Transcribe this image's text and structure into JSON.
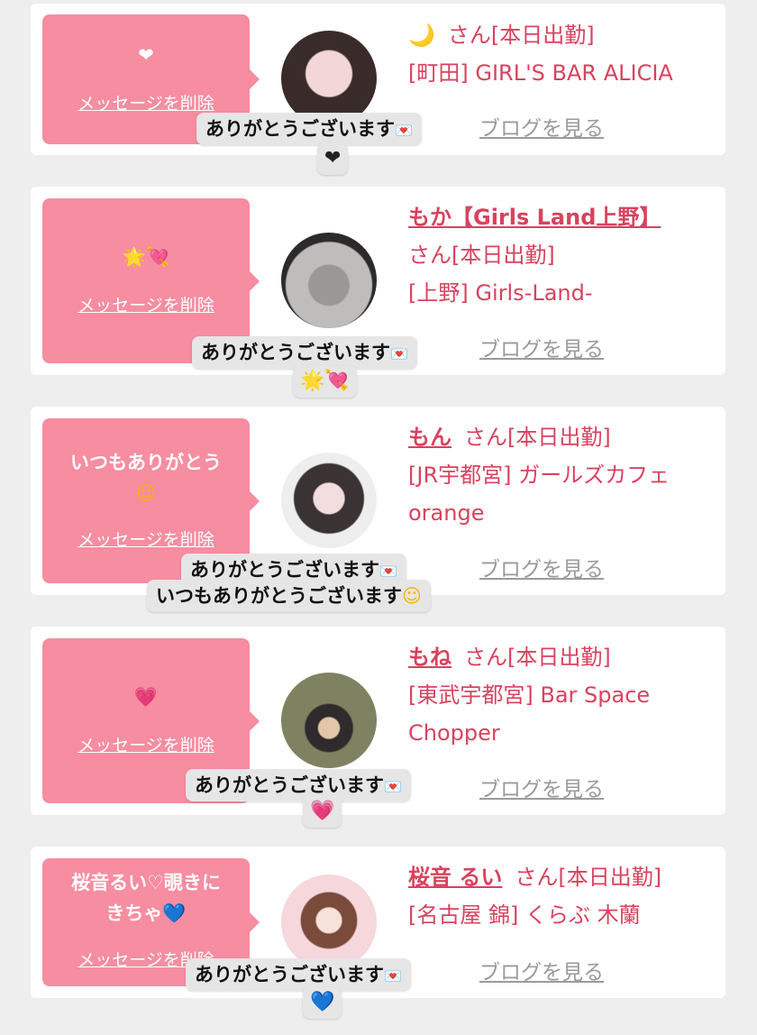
{
  "delete_label": "メッセージを削除",
  "san_suffix": "さん[本日出勤]",
  "blog_label": "ブログを見る",
  "thanks_prefix": "ありがとうございます",
  "icons": {
    "envelope": "💌",
    "heart_white": "❤",
    "heart_black": "❤",
    "star": "🌟",
    "heart_arrow": "💘",
    "smile": "☺",
    "heart_pink": "💗",
    "heart_blue": "💙",
    "moon": "🌙"
  },
  "cards": [
    {
      "bubble_icon": "❤",
      "name": "🌙",
      "san": "さん[本日出勤]",
      "shop_lines": [
        "[町田] GIRL'S BAR ALICIA"
      ],
      "reply_icon": "❤",
      "avatar_colors": [
        "#f3d6d6",
        "#3a2b2b"
      ]
    },
    {
      "bubble_icon": "🌟💘",
      "name": "もか【Girls Land上野】",
      "san": "さん[本日出勤]",
      "shop_lines": [
        "[上野] Girls-Land-"
      ],
      "reply_icon": "🌟💘",
      "avatar_colors": [
        "#bfbcbc",
        "#2c2a2a"
      ]
    },
    {
      "bubble_text": "いつもありがとう",
      "bubble_icon": "☺",
      "name": "もん",
      "san": "さん[本日出勤]",
      "shop_lines": [
        "[JR宇都宮] ガールズカフェ",
        "orange"
      ],
      "reply_text": "いつもありがとうございます",
      "reply_icon": "☺",
      "avatar_colors": [
        "#eeeeee",
        "#3b3333"
      ]
    },
    {
      "bubble_icon": "💗",
      "name": "もね",
      "san": "さん[本日出勤]",
      "shop_lines": [
        "[東武宇都宮] Bar Space",
        "Chopper"
      ],
      "reply_icon": "💗",
      "avatar_colors": [
        "#7e8261",
        "#2f2a2c"
      ]
    },
    {
      "bubble_text": "桜音るい♡覗きに",
      "bubble_text2": "きちゃ",
      "bubble_icon": "💙",
      "name": "桜音 るい",
      "san": "さん[本日出勤]",
      "shop_lines": [
        "[名古屋 錦] くらぶ 木蘭"
      ],
      "reply_icon": "💙",
      "avatar_colors": [
        "#f6d7dc",
        "#7a4a3b"
      ]
    }
  ],
  "colors": {
    "accent_pink": "#f68da1",
    "name_red": "#d9425e",
    "background": "#eeeeee"
  }
}
